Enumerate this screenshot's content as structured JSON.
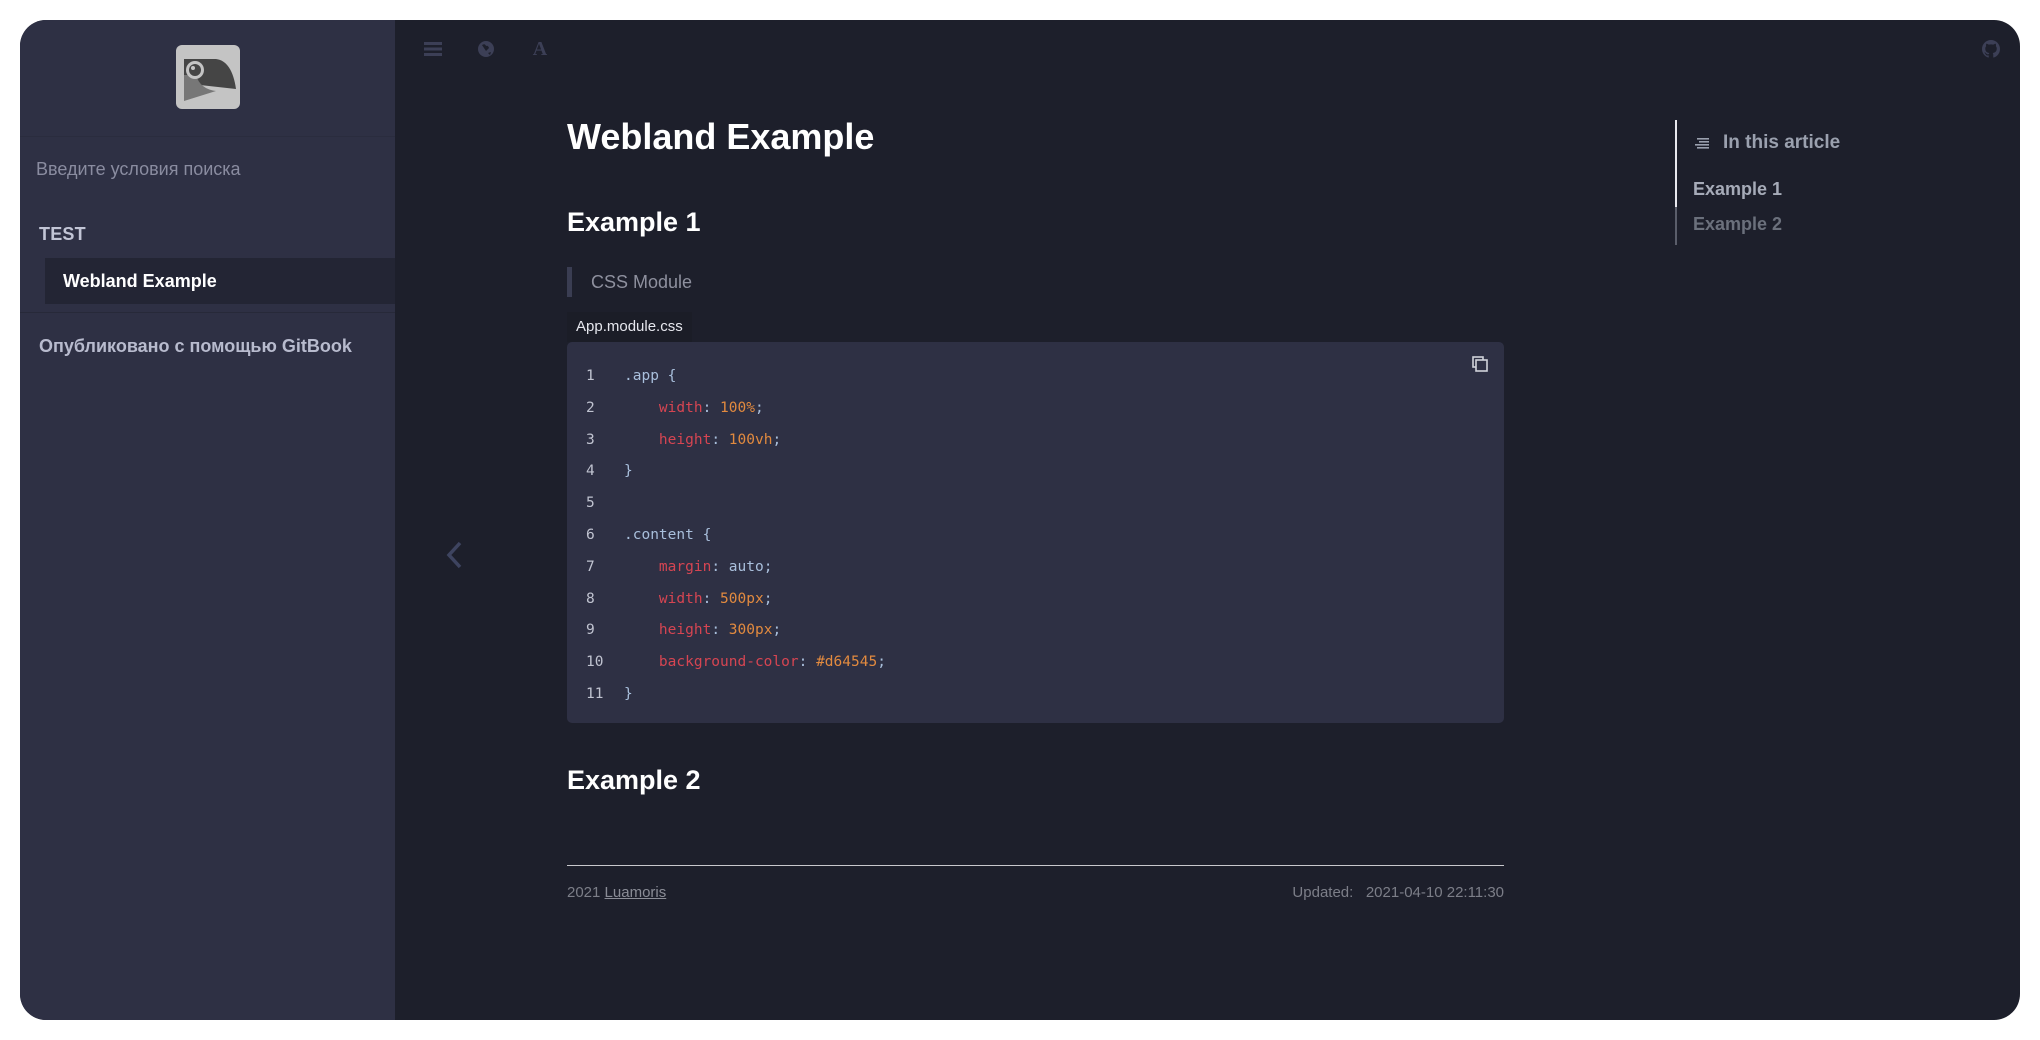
{
  "sidebar": {
    "logo_icon": "gitbook-bird-logo",
    "search": {
      "placeholder": "Введите условия поиска",
      "value": ""
    },
    "section_header": "TEST",
    "items": [
      {
        "label": "Webland Example",
        "active": true
      }
    ],
    "published_link": "Опубликовано с помощью GitBook"
  },
  "toolbar": {
    "icons": [
      "menu-icon",
      "globe-icon",
      "font-icon"
    ],
    "right_icon": "github-icon"
  },
  "main": {
    "title": "Webland Example",
    "sections": [
      {
        "heading": "Example 1"
      },
      {
        "heading": "Example 2"
      }
    ],
    "quote": "CSS Module",
    "code": {
      "filename": "App.module.css",
      "lines": [
        {
          "n": "1",
          "tokens": [
            [
              ".app ",
              "sel"
            ],
            [
              "{",
              "punc"
            ]
          ]
        },
        {
          "n": "2",
          "tokens": [
            [
              "    ",
              "punc"
            ],
            [
              "width",
              "prop"
            ],
            [
              ": ",
              "punc"
            ],
            [
              "100%",
              "num"
            ],
            [
              ";",
              "punc"
            ]
          ]
        },
        {
          "n": "3",
          "tokens": [
            [
              "    ",
              "punc"
            ],
            [
              "height",
              "prop"
            ],
            [
              ": ",
              "punc"
            ],
            [
              "100vh",
              "num"
            ],
            [
              ";",
              "punc"
            ]
          ]
        },
        {
          "n": "4",
          "tokens": [
            [
              "}",
              "punc"
            ]
          ]
        },
        {
          "n": "5",
          "tokens": []
        },
        {
          "n": "6",
          "tokens": [
            [
              ".content ",
              "sel"
            ],
            [
              "{",
              "punc"
            ]
          ]
        },
        {
          "n": "7",
          "tokens": [
            [
              "    ",
              "punc"
            ],
            [
              "margin",
              "prop"
            ],
            [
              ": ",
              "punc"
            ],
            [
              "auto",
              "kw"
            ],
            [
              ";",
              "punc"
            ]
          ]
        },
        {
          "n": "8",
          "tokens": [
            [
              "    ",
              "punc"
            ],
            [
              "width",
              "prop"
            ],
            [
              ": ",
              "punc"
            ],
            [
              "500px",
              "num"
            ],
            [
              ";",
              "punc"
            ]
          ]
        },
        {
          "n": "9",
          "tokens": [
            [
              "    ",
              "punc"
            ],
            [
              "height",
              "prop"
            ],
            [
              ": ",
              "punc"
            ],
            [
              "300px",
              "num"
            ],
            [
              ";",
              "punc"
            ]
          ]
        },
        {
          "n": "10",
          "tokens": [
            [
              "    ",
              "punc"
            ],
            [
              "background-color",
              "prop"
            ],
            [
              ": ",
              "punc"
            ],
            [
              "#d64545",
              "num"
            ],
            [
              ";",
              "punc"
            ]
          ]
        },
        {
          "n": "11",
          "tokens": [
            [
              "}",
              "punc"
            ]
          ]
        }
      ],
      "copy_icon": "copy-icon"
    },
    "footer": {
      "year": "2021",
      "author_link": "Luamoris",
      "updated_label": "Updated:",
      "updated_value": "2021-04-10 22:11:30"
    },
    "prev_icon": "chevron-left-icon"
  },
  "toc": {
    "title": "In this article",
    "items": [
      {
        "label": "Example 1",
        "active": true
      },
      {
        "label": "Example 2",
        "active": false
      }
    ]
  },
  "colors": {
    "sidebar_bg": "#2e3044",
    "main_bg": "#1d1f2b",
    "code_bg": "#2e3044",
    "code_property": "#d64552",
    "code_value": "#e28a3f",
    "code_selector": "#a9bfdc"
  }
}
